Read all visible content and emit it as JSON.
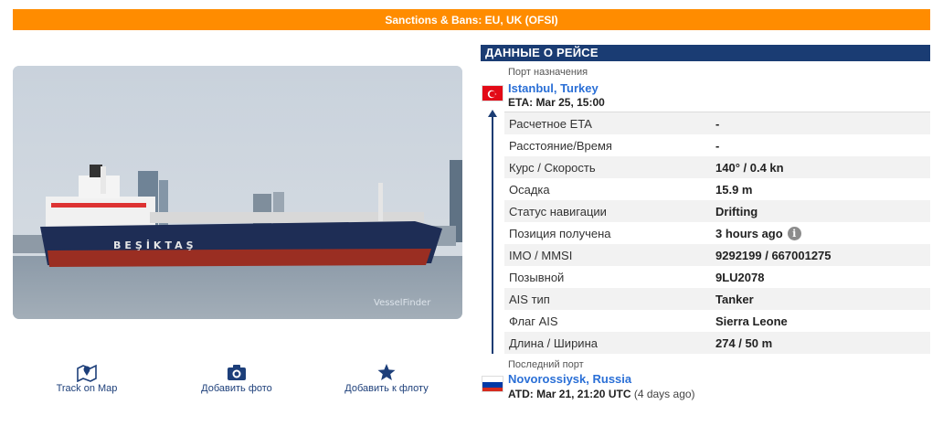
{
  "banner": {
    "text": "Sanctions & Bans: EU, UK (OFSI)"
  },
  "photo": {
    "hull_text": "BEŞİKTAŞ",
    "watermark": "VesselFinder"
  },
  "actions": [
    {
      "label": "Track on Map",
      "icon": "map-pin-icon"
    },
    {
      "label": "Добавить фото",
      "icon": "camera-icon"
    },
    {
      "label": "Добавить к флоту",
      "icon": "star-icon"
    }
  ],
  "voyage": {
    "header": "ДАННЫЕ О РЕЙСЕ",
    "destination": {
      "label": "Порт назначения",
      "city": "Istanbul",
      "country": "Turkey",
      "time_label": "ETA: Mar 25, 15:00",
      "flag": "turkey-flag"
    },
    "rows": [
      {
        "key": "Расчетное ETA",
        "value": "-"
      },
      {
        "key": "Расстояние/Время",
        "value": "-"
      },
      {
        "key": "Курс / Скорость",
        "value": "140° / 0.4 kn"
      },
      {
        "key": "Осадка",
        "value": "15.9 m"
      },
      {
        "key": "Статус навигации",
        "value": "Drifting"
      },
      {
        "key": "Позиция получена",
        "value": "3 hours ago"
      },
      {
        "key": "IMO / MMSI",
        "value": "9292199 / 667001275"
      },
      {
        "key": "Позывной",
        "value": "9LU2078"
      },
      {
        "key": "AIS тип",
        "value": "Tanker"
      },
      {
        "key": "Флаг AIS",
        "value": "Sierra Leone"
      },
      {
        "key": "Длина / Ширина",
        "value": "274 / 50 m"
      }
    ],
    "last_port": {
      "label": "Последний порт",
      "city": "Novorossiysk",
      "country": "Russia",
      "time_label": "ATD: Mar 21, 21:20 UTC",
      "time_note": "(4 days ago)",
      "flag": "russia-flag"
    }
  },
  "colors": {
    "banner": "#ff8c00",
    "header": "#1a3c73",
    "link": "#2a6fd6",
    "action": "#1d3f7a"
  }
}
